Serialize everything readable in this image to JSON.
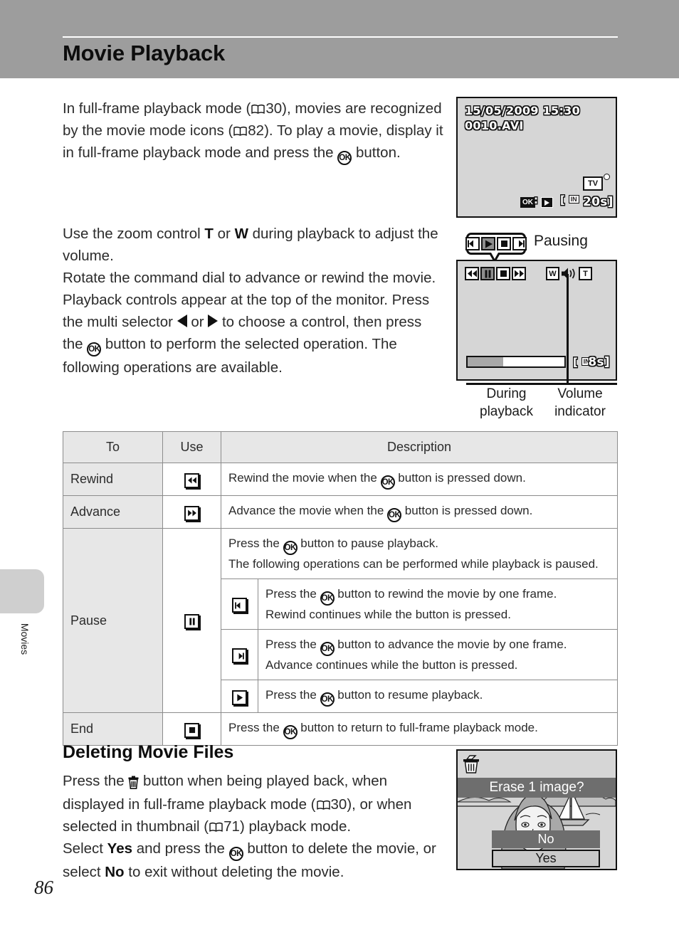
{
  "page": {
    "title": "Movie Playback",
    "number": "86",
    "side_tab_label": "Movies"
  },
  "intro": {
    "line1_a": "In full-frame playback mode (",
    "line1_ref": "30",
    "line1_b": "), movies are recognized by the movie mode icons (",
    "line1_ref2": "82",
    "line1_c": "). To play a movie, display it in full-frame playback mode and press the ",
    "line1_d": " button."
  },
  "controls_para": {
    "s1_a": "Use the zoom control ",
    "s1_T": "T",
    "s1_or": " or ",
    "s1_W": "W",
    "s1_b": " during playback to adjust the volume.",
    "s2": "Rotate the command dial to advance or rewind the movie.",
    "s3_a": "Playback controls appear at the top of the monitor. Press the multi selector ",
    "s3_or": " or ",
    "s3_b": " to choose a control, then press the ",
    "s3_c": " button to perform the selected operation. The following operations are available."
  },
  "screen_full_frame": {
    "datetime": "15/05/2009 15:30",
    "filename": "0010.AVI",
    "ok_chip": "OK",
    "separator": ":",
    "memory_badge": "IN",
    "duration": "20s]",
    "tv_badge": "TV"
  },
  "screen_playback": {
    "callout_label": "Pausing",
    "label_during": "During",
    "label_during2": "playback",
    "label_volume": "Volume",
    "label_volume2": "indicator",
    "volume_w": "W",
    "volume_t": "T",
    "memory_badge": "IN",
    "remaining": "8s]",
    "progress_percent": 37,
    "callout_buttons": [
      "rewind-frame-icon",
      "play-icon",
      "stop-icon",
      "advance-frame-icon"
    ],
    "screen_buttons": [
      "rewind-icon",
      "pause-icon",
      "stop-icon",
      "advance-icon"
    ]
  },
  "table": {
    "headers": [
      "To",
      "Use",
      "Description"
    ],
    "rows": [
      {
        "to": "Rewind",
        "use_icon": "rewind-icon",
        "desc_a": "Rewind the movie when the ",
        "desc_b": " button is pressed down."
      },
      {
        "to": "Advance",
        "use_icon": "advance-icon",
        "desc_a": "Advance the movie when the ",
        "desc_b": " button is pressed down."
      },
      {
        "to": "Pause",
        "use_icon": "pause-icon",
        "intro_a": "Press the ",
        "intro_b": " button to pause playback.",
        "intro_c": "The following operations can be performed while playback is paused.",
        "subrows": [
          {
            "icon": "rewind-frame-icon",
            "line1_a": "Press the ",
            "line1_b": " button to rewind the movie by one frame.",
            "line2": "Rewind continues while the button is pressed."
          },
          {
            "icon": "advance-frame-icon",
            "line1_a": "Press the ",
            "line1_b": " button to advance the movie by one frame.",
            "line2": "Advance continues while the button is pressed."
          },
          {
            "icon": "play-icon",
            "line1_a": "Press the ",
            "line1_b": " button to resume playback.",
            "line2": ""
          }
        ]
      },
      {
        "to": "End",
        "use_icon": "stop-icon",
        "desc_a": "Press the ",
        "desc_b": " button to return to full-frame playback mode."
      }
    ]
  },
  "deleting": {
    "heading": "Deleting Movie Files",
    "p1_a": "Press the ",
    "p1_b": " button when being played back, when displayed in full-frame playback mode (",
    "p1_ref": "30",
    "p1_c": "), or when selected in thumbnail (",
    "p1_ref2": "71",
    "p1_d": ") playback mode.",
    "p2_a": "Select ",
    "p2_yes": "Yes",
    "p2_b": " and press the ",
    "p2_c": " button to delete the movie, or select ",
    "p2_no": "No",
    "p2_d": " to exit without deleting the movie."
  },
  "erase_dialog": {
    "banner": "Erase 1 image?",
    "option_no": "No",
    "option_yes": "Yes",
    "trash_icon": "trash-icon"
  },
  "colors": {
    "header_band": "#9d9d9d",
    "screen_bg": "#d6d6d6",
    "table_header_bg": "#e7e7e7",
    "selected_bg": "#6e6e6e"
  }
}
